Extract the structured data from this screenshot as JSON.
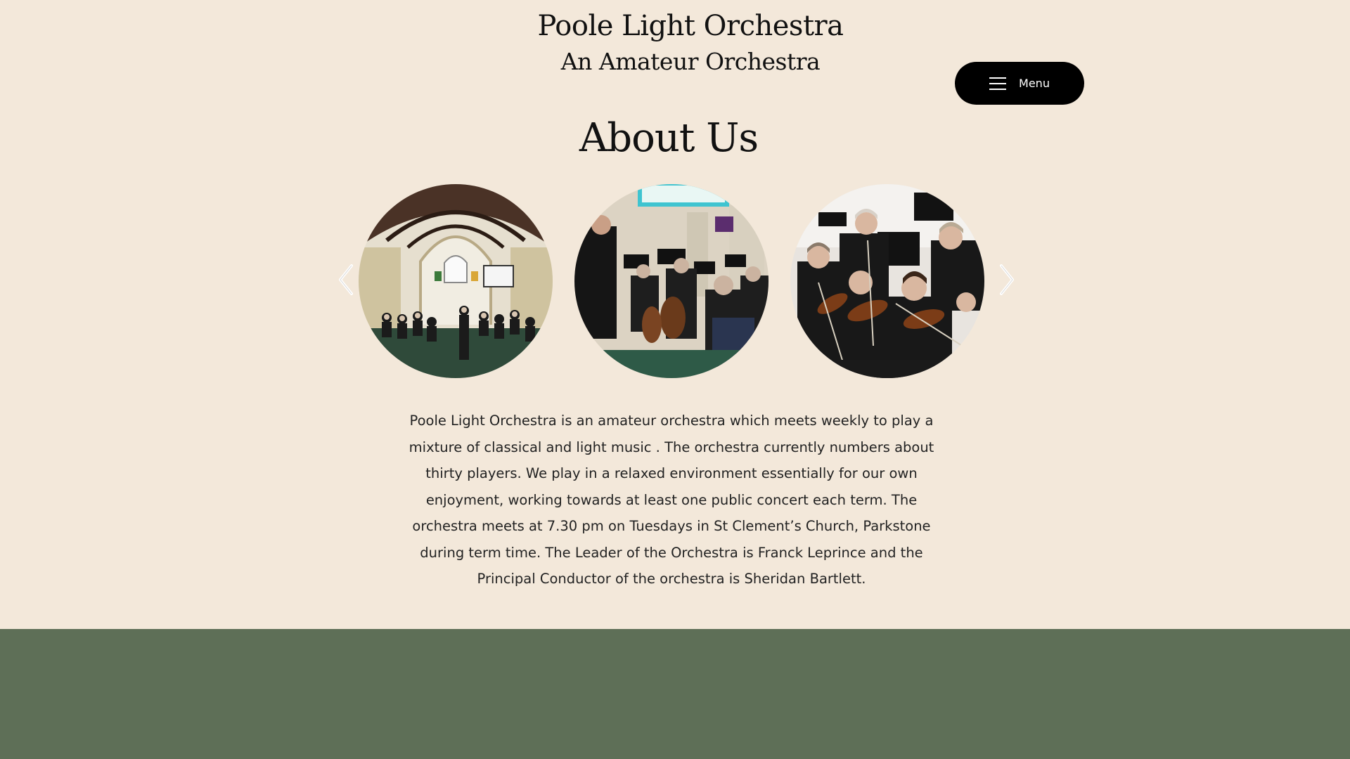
{
  "header": {
    "site_title": "Poole Light Orchestra",
    "site_subtitle": "An Amateur Orchestra",
    "menu_label": "Menu"
  },
  "about": {
    "title": "About Us",
    "text": "Poole Light Orchestra is an amateur orchestra which meets weekly to play a mixture of classical and light music . The orchestra currently numbers about thirty players. We play in a relaxed environment essentially for our own enjoyment, working towards at least one public concert each term.  The orchestra meets at 7.30 pm on Tuesdays in St Clement’s Church, Parkstone during term time.  The Leader of the Orchestra is Franck Leprince and the Principal Conductor of the orchestra is Sheridan Bartlett."
  },
  "gallery": {
    "prev_icon": "chevron-left-icon",
    "next_icon": "chevron-right-icon",
    "photos": [
      {
        "description_icon": "church-interior-photo"
      },
      {
        "description_icon": "orchestra-rehearsal-photo"
      },
      {
        "description_icon": "violin-section-photo"
      }
    ]
  },
  "colors": {
    "background": "#f3e8da",
    "footer": "#5e6f57",
    "menu_button": "#000000",
    "text": "#222222"
  }
}
